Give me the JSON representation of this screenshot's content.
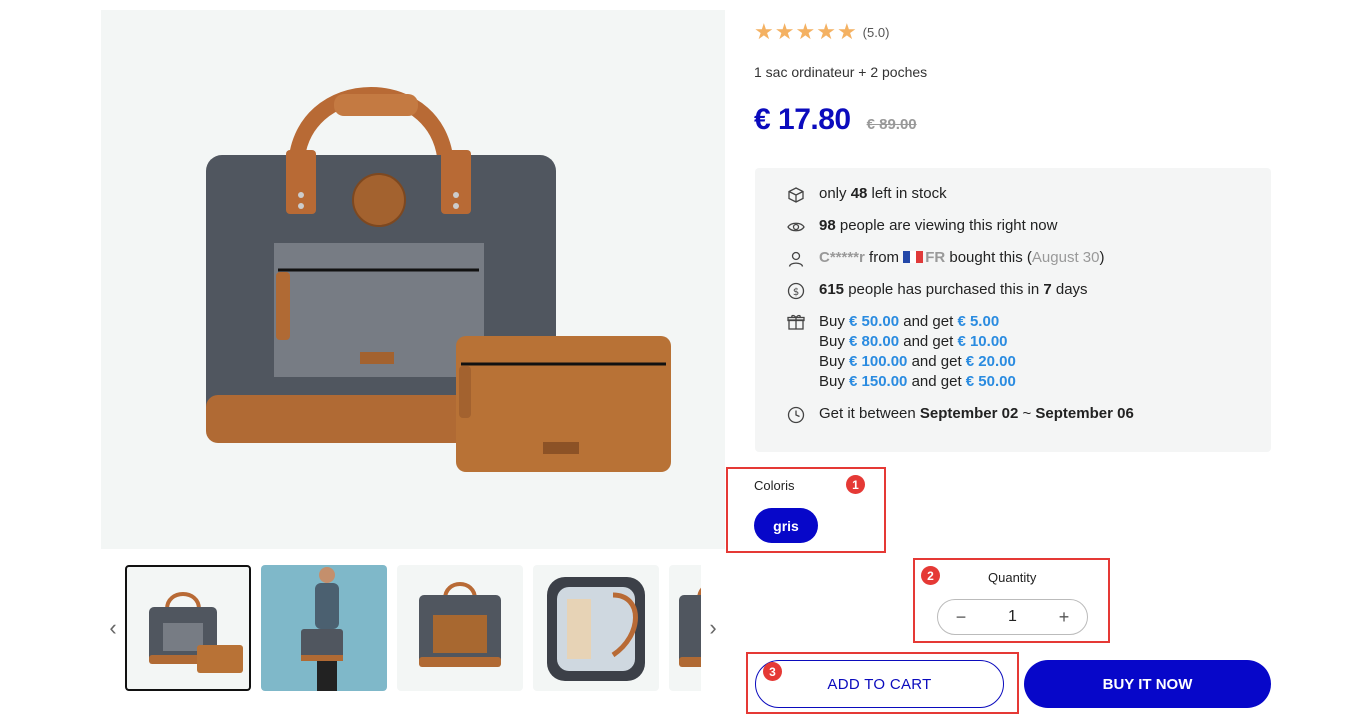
{
  "product": {
    "rating_stars": 5,
    "rating_value": "(5.0)",
    "subtitle": "1 sac ordinateur + 2 poches",
    "price": "€ 17.80",
    "compare_price": "€ 89.00"
  },
  "thumbnails": {
    "prev_icon": "chevron-left-icon",
    "next_icon": "chevron-right-icon",
    "items": [
      "thumb-bag-front",
      "thumb-model",
      "thumb-bag-side",
      "thumb-bag-open",
      "thumb-bag-partial"
    ],
    "active_index": 0
  },
  "info": {
    "stock": {
      "pre": "only ",
      "count": "48",
      "post": " left in stock"
    },
    "viewers": {
      "count": "98",
      "post": " people are viewing this right now"
    },
    "recent": {
      "name": "C*****r",
      "from": " from ",
      "country": "FR",
      "mid": " bought this (",
      "date": "August 30",
      "end": ")"
    },
    "purchased": {
      "count": "615",
      "mid": " people has purchased this in ",
      "days": "7",
      "post": " days"
    },
    "promos": [
      {
        "buy": "Buy ",
        "amount": "€ 50.00",
        "get": " and get ",
        "reward": "€ 5.00"
      },
      {
        "buy": "Buy ",
        "amount": "€ 80.00",
        "get": " and get ",
        "reward": "€ 10.00"
      },
      {
        "buy": "Buy ",
        "amount": "€ 100.00",
        "get": " and get ",
        "reward": "€ 20.00"
      },
      {
        "buy": "Buy ",
        "amount": "€ 150.00",
        "get": " and get ",
        "reward": "€ 50.00"
      }
    ],
    "delivery": {
      "pre": "Get it between ",
      "start": "September 02",
      "sep": " ~ ",
      "end": "September 06"
    }
  },
  "variant": {
    "label": "Coloris",
    "options": [
      "gris"
    ],
    "selected": "gris"
  },
  "quantity": {
    "label": "Quantity",
    "value": "1",
    "minus": "−",
    "plus": "+"
  },
  "actions": {
    "add_to_cart": "ADD TO CART",
    "buy_now": "BUY IT NOW"
  },
  "markers": [
    "1",
    "2",
    "3"
  ],
  "colors": {
    "primary": "#0707c9",
    "price": "#0b0bbd",
    "promo": "#2a8be0",
    "star": "#f4b162",
    "marker": "#e53935"
  }
}
